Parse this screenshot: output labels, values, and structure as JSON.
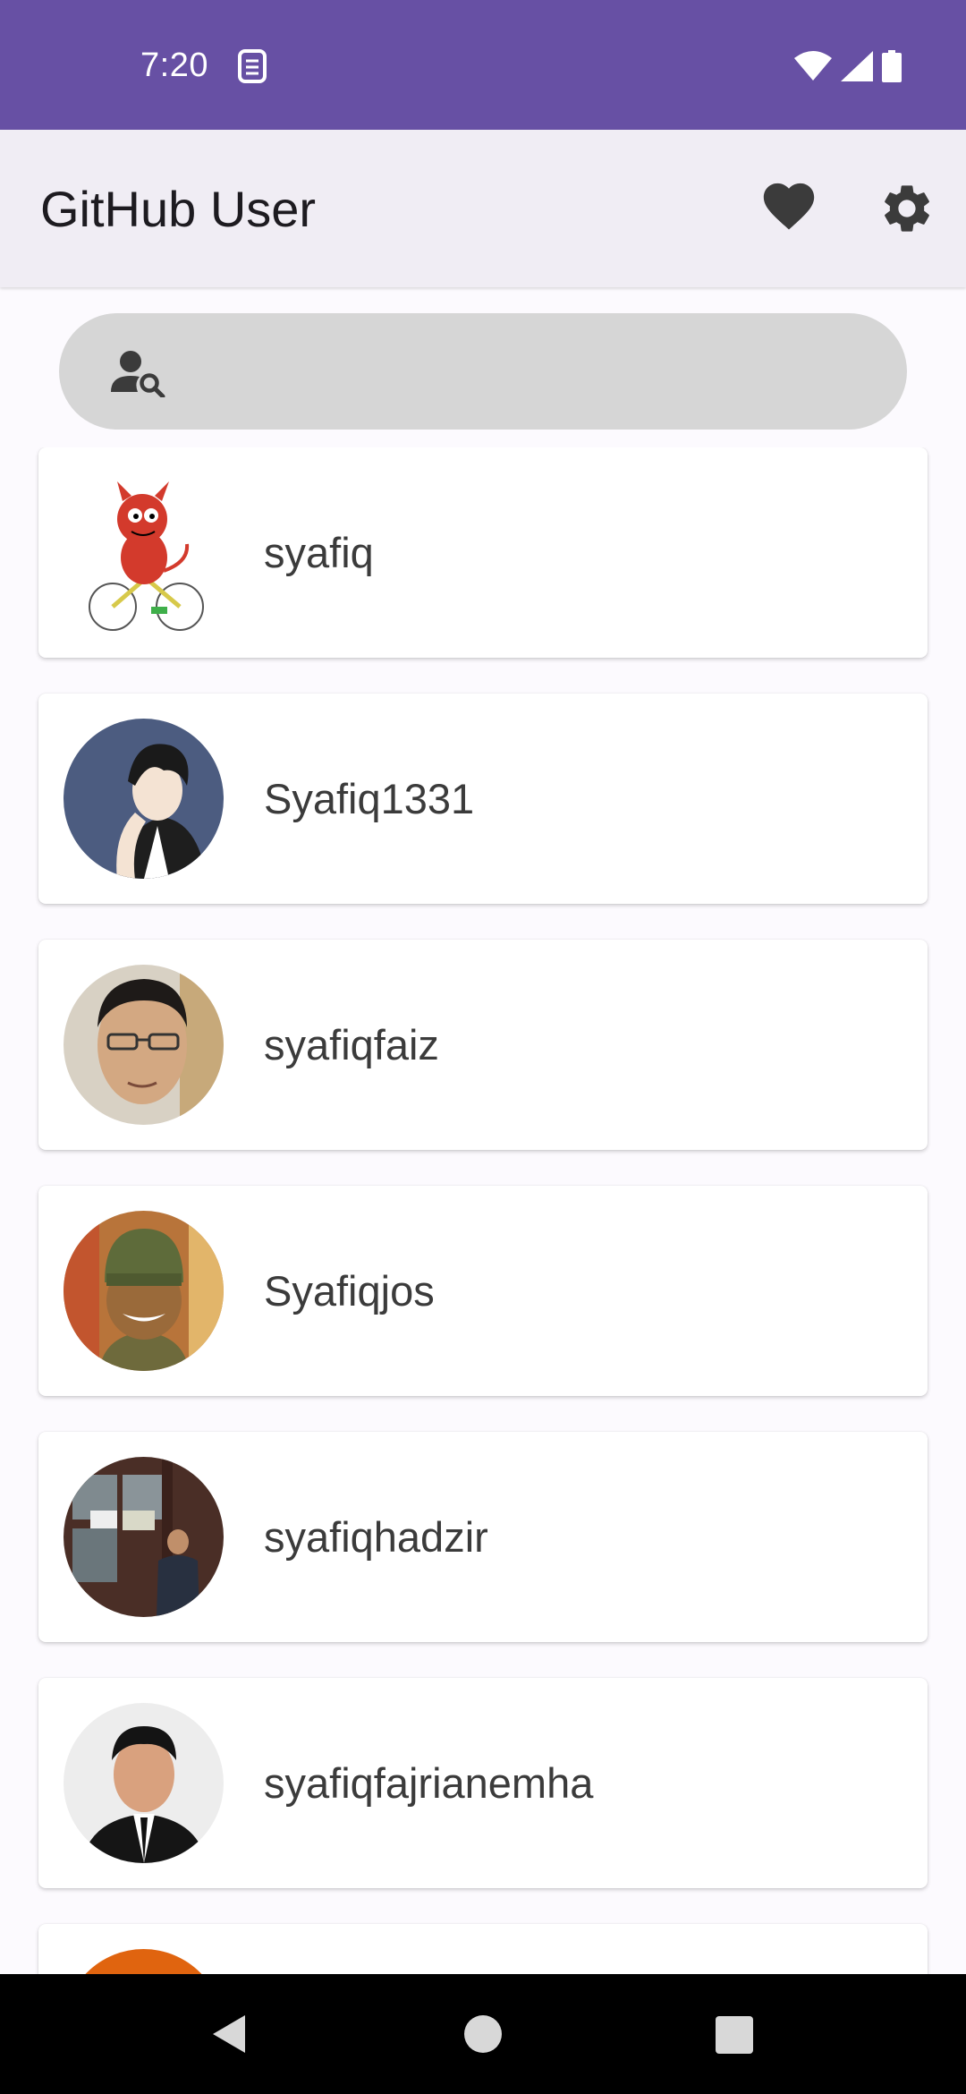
{
  "status_bar": {
    "time": "7:20",
    "background": "#6750A4"
  },
  "app_bar": {
    "title": "GitHub User",
    "favorite_icon": "heart-icon",
    "settings_icon": "gear-icon"
  },
  "search": {
    "icon": "person-search-icon",
    "value": "",
    "placeholder": ""
  },
  "users": [
    {
      "username": "syafiq"
    },
    {
      "username": "Syafiq1331"
    },
    {
      "username": "syafiqfaiz"
    },
    {
      "username": "Syafiqjos"
    },
    {
      "username": "syafiqhadzir"
    },
    {
      "username": "syafiqfajrianemha"
    },
    {
      "username": ""
    }
  ],
  "nav_bar": {
    "back_icon": "back-triangle-icon",
    "home_icon": "home-circle-icon",
    "recents_icon": "recents-square-icon"
  }
}
